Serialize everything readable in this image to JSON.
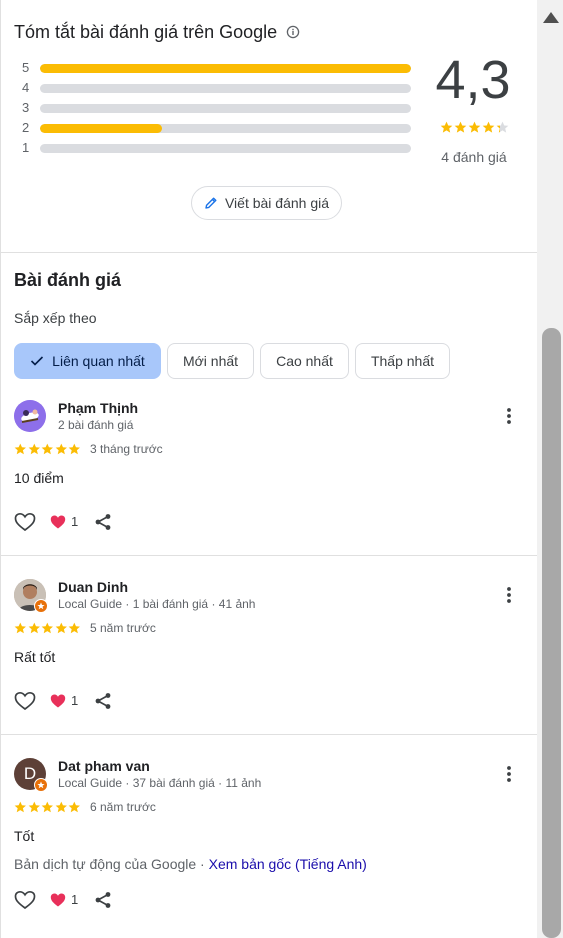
{
  "summary": {
    "title": "Tóm tắt bài đánh giá trên Google",
    "rating": "4,3",
    "rating_value": 4.3,
    "review_count": "4 đánh giá",
    "write_review_label": "Viết bài đánh giá",
    "distribution": [
      {
        "stars": "5",
        "fraction": 1.0
      },
      {
        "stars": "4",
        "fraction": 0.0
      },
      {
        "stars": "3",
        "fraction": 0.0
      },
      {
        "stars": "2",
        "fraction": 0.33
      },
      {
        "stars": "1",
        "fraction": 0.0
      }
    ]
  },
  "reviews_section": {
    "title": "Bài đánh giá",
    "sort_label": "Sắp xếp theo",
    "sort_options": [
      {
        "label": "Liên quan nhất",
        "selected": true
      },
      {
        "label": "Mới nhất",
        "selected": false
      },
      {
        "label": "Cao nhất",
        "selected": false
      },
      {
        "label": "Thấp nhất",
        "selected": false
      }
    ]
  },
  "reviews": [
    {
      "name": "Phạm Thịnh",
      "meta": "2 bài đánh giá",
      "rating": 5,
      "date": "3 tháng trước",
      "text": "10 điểm",
      "likes": "1",
      "local_guide": false
    },
    {
      "name": "Duan Dinh",
      "meta": "Local Guide · 1 bài đánh giá · 41 ảnh",
      "rating": 5,
      "date": "5 năm trước",
      "text": "Rất tốt",
      "likes": "1",
      "local_guide": true
    },
    {
      "name": "Dat pham van",
      "meta": "Local Guide · 37 bài đánh giá · 11 ảnh",
      "avatar_letter": "D",
      "rating": 5,
      "date": "6 năm trước",
      "text": "Tốt",
      "translation_note": "Bản dịch tự động của Google · ",
      "translation_link": "Xem bản gốc (Tiếng Anh)",
      "likes": "1",
      "local_guide": true
    }
  ],
  "colors": {
    "star": "#fbbc04",
    "bar_track": "#dadce0",
    "chip_active": "#a8c7fa",
    "heart": "#e8305a",
    "link": "#1a0dab",
    "local_guide_badge": "#e8710a"
  },
  "icons": [
    "info-icon",
    "pencil-icon",
    "check-icon",
    "more-vert-icon",
    "thumb-like-icon",
    "heart-reaction-icon",
    "share-icon",
    "scroll-up-arrow-icon"
  ]
}
